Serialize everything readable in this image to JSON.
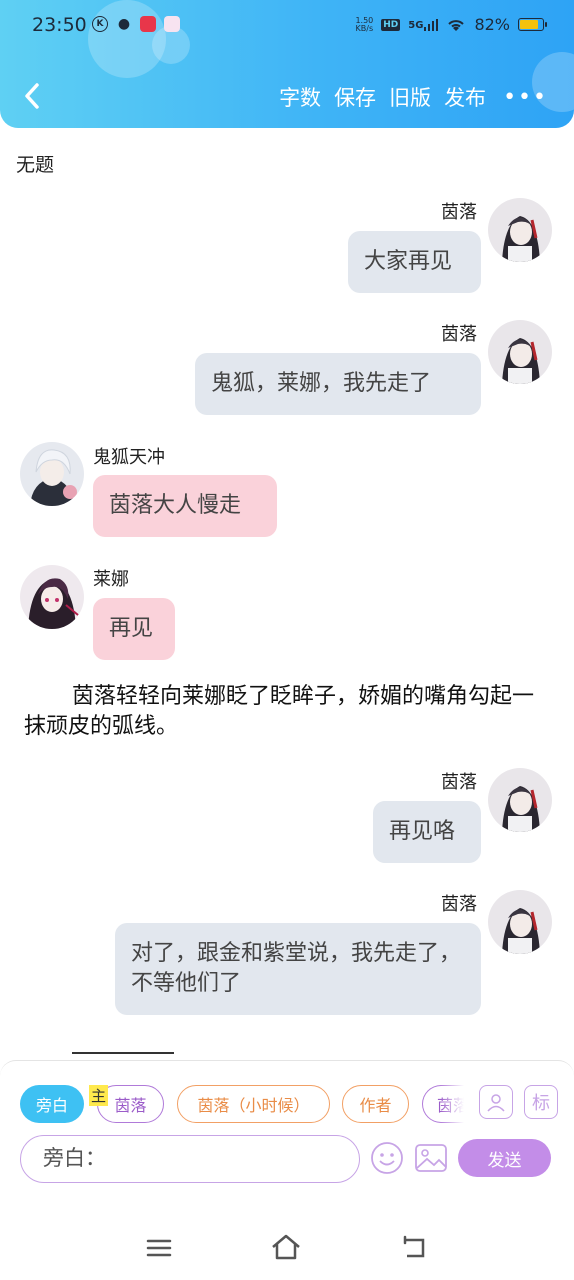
{
  "status_bar": {
    "time": "23:50",
    "net_speed_value": "1.50",
    "net_speed_unit": "KB/s",
    "hd_badge": "HD",
    "network": "5G",
    "battery_text": "82%",
    "battery_level": 0.82,
    "notif_icons": [
      "k-icon",
      "wechat-icon",
      "news-app-icon",
      "pink-app-icon"
    ]
  },
  "header": {
    "toolbar": {
      "word_count_label": "字数",
      "save_label": "保存",
      "old_version_label": "旧版",
      "publish_label": "发布",
      "more_label": "•••"
    },
    "accent_color": "#3fb4f6"
  },
  "document": {
    "title": "无题",
    "messages": [
      {
        "side": "right",
        "speaker": "茵落",
        "text": "大家再见"
      },
      {
        "side": "right",
        "speaker": "茵落",
        "text": "鬼狐，莱娜，我先走了"
      },
      {
        "side": "left",
        "speaker": "鬼狐天冲",
        "text": "茵落大人慢走"
      },
      {
        "side": "left",
        "speaker": "莱娜",
        "text": "再见"
      },
      {
        "type": "narration",
        "text": "茵落轻轻向莱娜眨了眨眸子，娇媚的嘴角勾起一抹顽皮的弧线。"
      },
      {
        "side": "right",
        "speaker": "茵落",
        "text": "再见咯"
      },
      {
        "side": "right",
        "speaker": "茵落",
        "text": "对了，跟金和紫堂说，我先走了，不等他们了"
      }
    ]
  },
  "composer": {
    "roles": [
      "旁白",
      "茵落",
      "茵落（小时候）",
      "作者",
      "茵落"
    ],
    "main_tag": "主",
    "active_role": "旁白",
    "input_value": "旁白：",
    "send_label": "发送",
    "tag_icon_label": "标",
    "send_color": "#c38de8"
  },
  "nav_bar": {
    "buttons": [
      "menu-icon",
      "home-icon",
      "back-icon"
    ]
  }
}
